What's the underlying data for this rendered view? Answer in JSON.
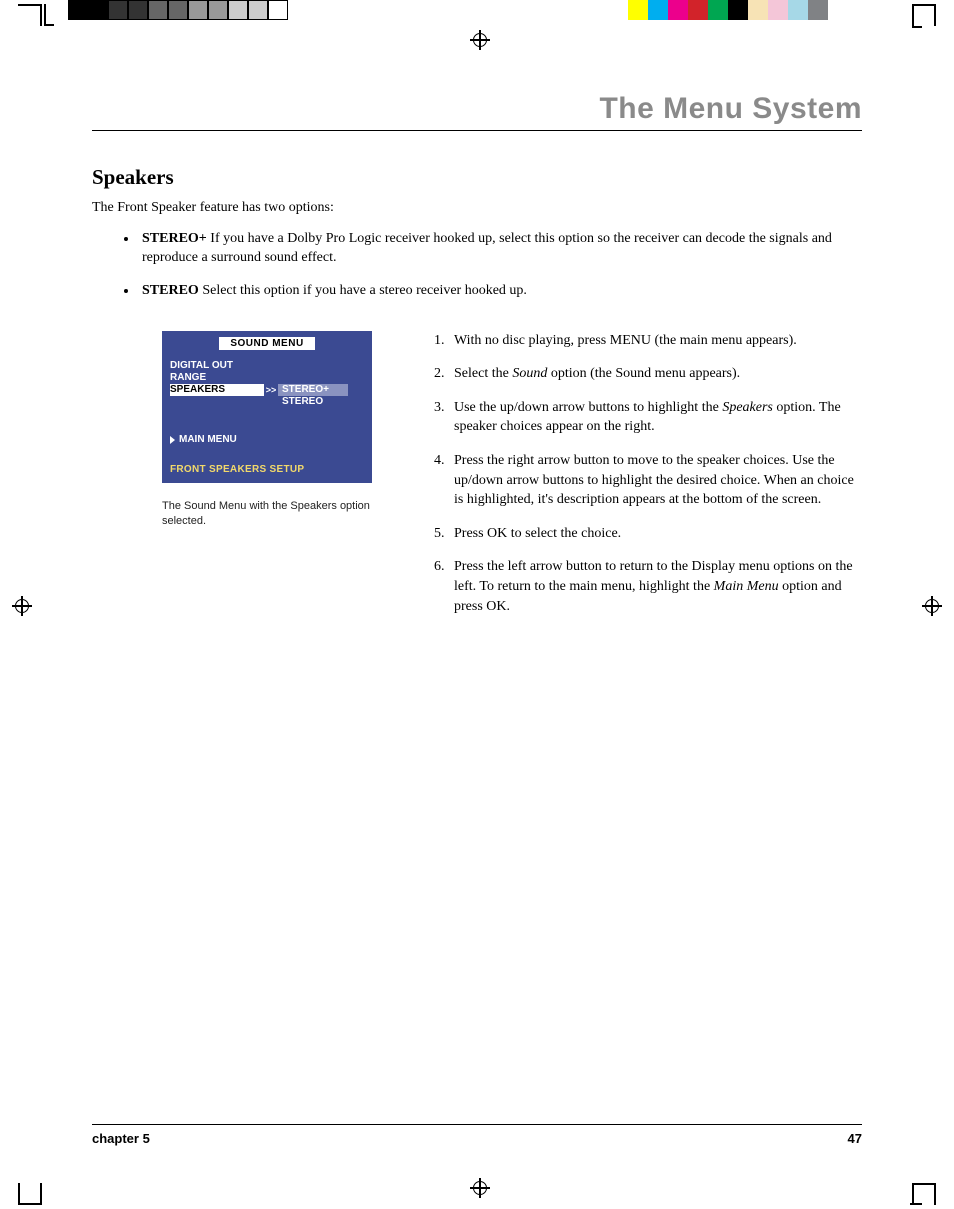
{
  "colors": {
    "left_bar": [
      "#000000",
      "#000000",
      "#333333",
      "#333333",
      "#666666",
      "#666666",
      "#999999",
      "#999999",
      "#cccccc",
      "#cccccc",
      "#ffffff"
    ],
    "right_bar": [
      "#ffff00",
      "#00aeef",
      "#ec008c",
      "#d2232a",
      "#00a651",
      "#000000",
      "#f7e3b5",
      "#f4c6d8",
      "#a6d8e7",
      "#808285"
    ]
  },
  "header": {
    "title": "The Menu System"
  },
  "section": {
    "heading": "Speakers",
    "intro": "The Front Speaker feature has two options:",
    "bullets": [
      {
        "lead": "STEREO+",
        "text": "  If you have a Dolby Pro Logic receiver hooked up, select this option so the receiver can decode the signals and reproduce a surround sound effect."
      },
      {
        "lead": "STEREO",
        "text": "   Select this option if you have a stereo receiver hooked up."
      }
    ]
  },
  "menu": {
    "title": "SOUND MENU",
    "items": [
      "DIGITAL OUT",
      "RANGE",
      "SPEAKERS"
    ],
    "arrow": ">>",
    "options": [
      "STEREO+",
      "STEREO"
    ],
    "main": "MAIN MENU",
    "footer": "FRONT SPEAKERS SETUP"
  },
  "caption": "The Sound Menu with the Speakers option selected.",
  "steps": [
    {
      "pre": "With no disc playing, press MENU (the main menu appears).",
      "em": "",
      "post": ""
    },
    {
      "pre": "Select the ",
      "em": "Sound",
      "post": " option (the Sound menu appears)."
    },
    {
      "pre": "Use the up/down arrow buttons to highlight the ",
      "em": "Speakers",
      "post": " option.  The speaker choices appear on the right."
    },
    {
      "pre": "Press the right arrow button to move to the speaker choices. Use the up/down arrow buttons to highlight the desired choice. When an choice is highlighted, it's description appears at the bottom of the screen.",
      "em": "",
      "post": ""
    },
    {
      "pre": "Press OK to select the choice.",
      "em": "",
      "post": ""
    },
    {
      "pre": "Press the left arrow button to return to the Display menu options on the left. To return to the main menu, highlight the ",
      "em": "Main Menu",
      "post": " option and press OK."
    }
  ],
  "footer": {
    "chapter": "chapter 5",
    "page": "47"
  }
}
